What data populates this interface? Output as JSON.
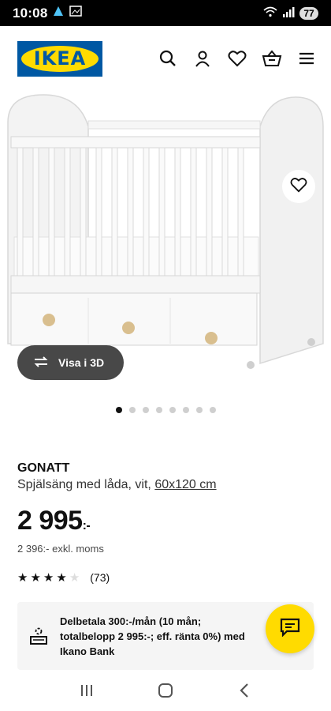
{
  "status_bar": {
    "time": "10:08",
    "battery": "77"
  },
  "header": {
    "logo_text": "IKEA",
    "icons": [
      "search-icon",
      "user-icon",
      "heart-icon",
      "basket-icon",
      "menu-icon"
    ]
  },
  "gallery": {
    "view_3d_label": "Visa i 3D",
    "image_count": 8,
    "active_index": 0
  },
  "product": {
    "name": "GONATT",
    "description": "Spjälsäng med låda, vit,",
    "dimensions": "60x120 cm",
    "price": "2 995",
    "price_suffix": ":-",
    "ex_vat": "2 396:- exkl. moms",
    "rating": 4,
    "rating_max": 5,
    "reviews": "(73)"
  },
  "finance": {
    "text": "Delbetala 300:-/mån (10 mån; totalbelopp 2 995:-; eff. ränta 0%) med Ikano Bank"
  },
  "colors": {
    "brand_blue": "#0058a3",
    "brand_yellow": "#ffdb00"
  }
}
